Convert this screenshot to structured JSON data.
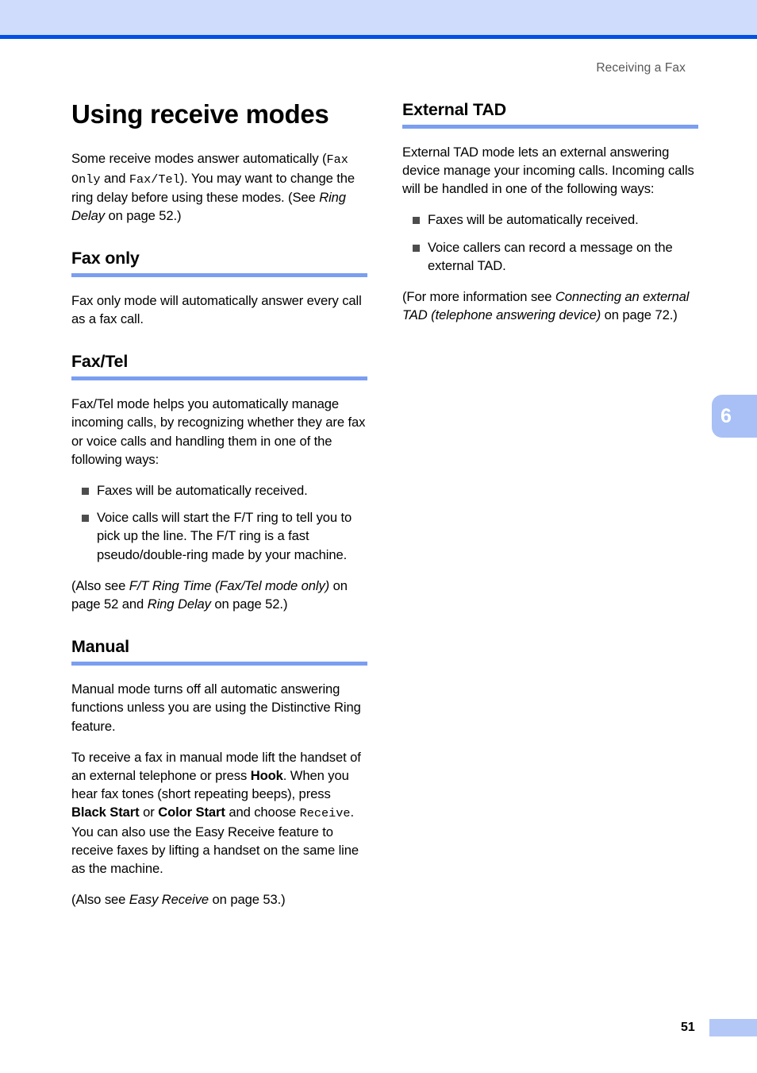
{
  "document": {
    "running_header": "Receiving a Fax",
    "page_number": "51",
    "chapter_tab": "6"
  },
  "left_column": {
    "chapter_title": "Using receive modes",
    "intro": {
      "t1": "Some receive modes answer automatically (",
      "code1": "Fax Only",
      "t2": " and ",
      "code2": "Fax/Tel",
      "t3": "). You may want to change the ring delay before using these modes. (See ",
      "ital1": "Ring Delay",
      "t4": " on page 52.)"
    },
    "fax_only": {
      "heading": "Fax only",
      "body": "Fax only mode will automatically answer every call as a fax call."
    },
    "fax_tel": {
      "heading": "Fax/Tel",
      "body": "Fax/Tel mode helps you automatically manage incoming calls, by recognizing whether they are fax or voice calls and handling them in one of the following ways:",
      "bullets": [
        "Faxes will be automatically received.",
        "Voice calls will start the F/T ring to tell you to pick up the line. The F/T ring is a fast pseudo/double-ring made by your machine."
      ],
      "note": {
        "t1": "(Also see ",
        "ital1": "F/T Ring Time (Fax/Tel mode only)",
        "t2": " on page 52 and ",
        "ital2": "Ring Delay",
        "t3": " on page 52.)"
      }
    },
    "manual": {
      "heading": "Manual",
      "body1": "Manual mode turns off all automatic answering functions unless you are using the Distinctive Ring feature.",
      "body2": {
        "t1": "To receive a fax in manual mode lift the handset of an external telephone or press ",
        "bold1": "Hook",
        "t2": ". When you hear fax tones (short repeating beeps), press ",
        "bold2": "Black Start",
        "t3": " or ",
        "bold3": "Color Start",
        "t4": " and choose ",
        "code1": "Receive",
        "t5": ". You can also use the Easy Receive feature to receive faxes by lifting a handset on the same line as the machine."
      },
      "note": {
        "t1": "(Also see ",
        "ital1": "Easy Receive",
        "t2": " on page 53.)"
      }
    }
  },
  "right_column": {
    "external_tad": {
      "heading": "External TAD",
      "body": "External TAD mode lets an external answering device manage your incoming calls. Incoming calls will be handled in one of the following ways:",
      "bullets": [
        "Faxes will be automatically received.",
        "Voice callers can record a message on the external TAD."
      ],
      "note": {
        "t1": "(For more information see ",
        "ital1": "Connecting an external TAD (telephone answering device)",
        "t2": " on page 72.)"
      }
    }
  },
  "colors": {
    "band_fill": "#cfdcfb",
    "band_rule": "#0050e6",
    "heading_rule": "#7b9ef0",
    "tab_fill": "#a8c0f5",
    "bullet": "#4d4d4d",
    "header_text": "#58585a"
  }
}
